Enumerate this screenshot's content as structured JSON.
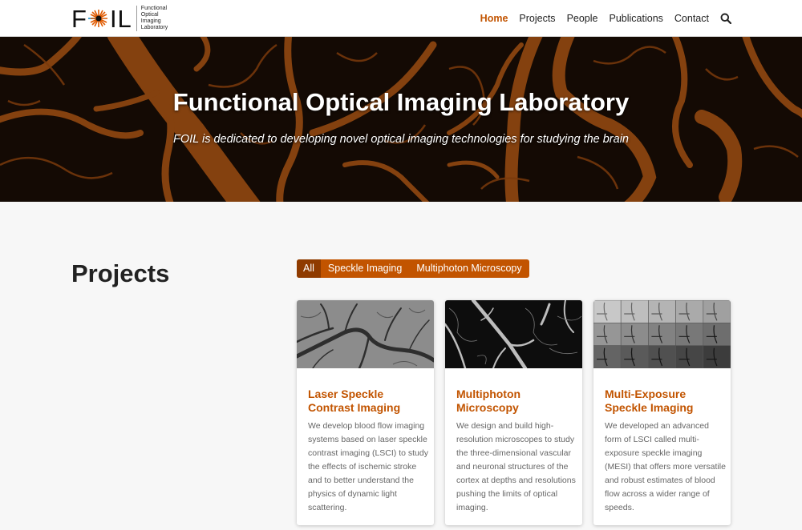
{
  "logo": {
    "letters_left": "F",
    "letters_right": "IL",
    "subtitle_lines": [
      "Functional",
      "Optical",
      "Imaging",
      "Laboratory"
    ]
  },
  "nav": {
    "items": [
      {
        "label": "Home",
        "active": true
      },
      {
        "label": "Projects",
        "active": false
      },
      {
        "label": "People",
        "active": false
      },
      {
        "label": "Publications",
        "active": false
      },
      {
        "label": "Contact",
        "active": false
      }
    ],
    "search_icon": "search-icon"
  },
  "hero": {
    "title": "Functional Optical Imaging Laboratory",
    "subtitle": "FOIL is dedicated to developing novel optical imaging technologies for studying the brain"
  },
  "projects": {
    "heading": "Projects",
    "filters": [
      {
        "label": "All",
        "active": true
      },
      {
        "label": "Speckle Imaging",
        "active": false
      },
      {
        "label": "Multiphoton Microscopy",
        "active": false
      }
    ],
    "cards": [
      {
        "title": "Laser Speckle Contrast Imaging",
        "description": "We develop blood flow imaging systems based on laser speckle contrast imaging (LSCI) to study the effects of ischemic stroke and to better understand the physics of dynamic light scattering.",
        "image": "grayscale vessel speckle image"
      },
      {
        "title": "Multiphoton Microscopy",
        "description": "We design and build high-resolution microscopes to study the three-dimensional vascular and neuronal structures of the cortex at depths and resolutions pushing the limits of optical imaging.",
        "image": "multiphoton vasculature image"
      },
      {
        "title": "Multi-Exposure Speckle Imaging",
        "description": "We developed an advanced form of LSCI called multi-exposure speckle imaging (MESI) that offers more versatile and robust estimates of blood flow across a wider range of speeds.",
        "image": "multi-exposure image grid"
      }
    ]
  },
  "colors": {
    "accent": "#c25400",
    "accent_dark": "#8f3b00",
    "hero_bg": "#140a04",
    "vessel": "#a4520f"
  }
}
